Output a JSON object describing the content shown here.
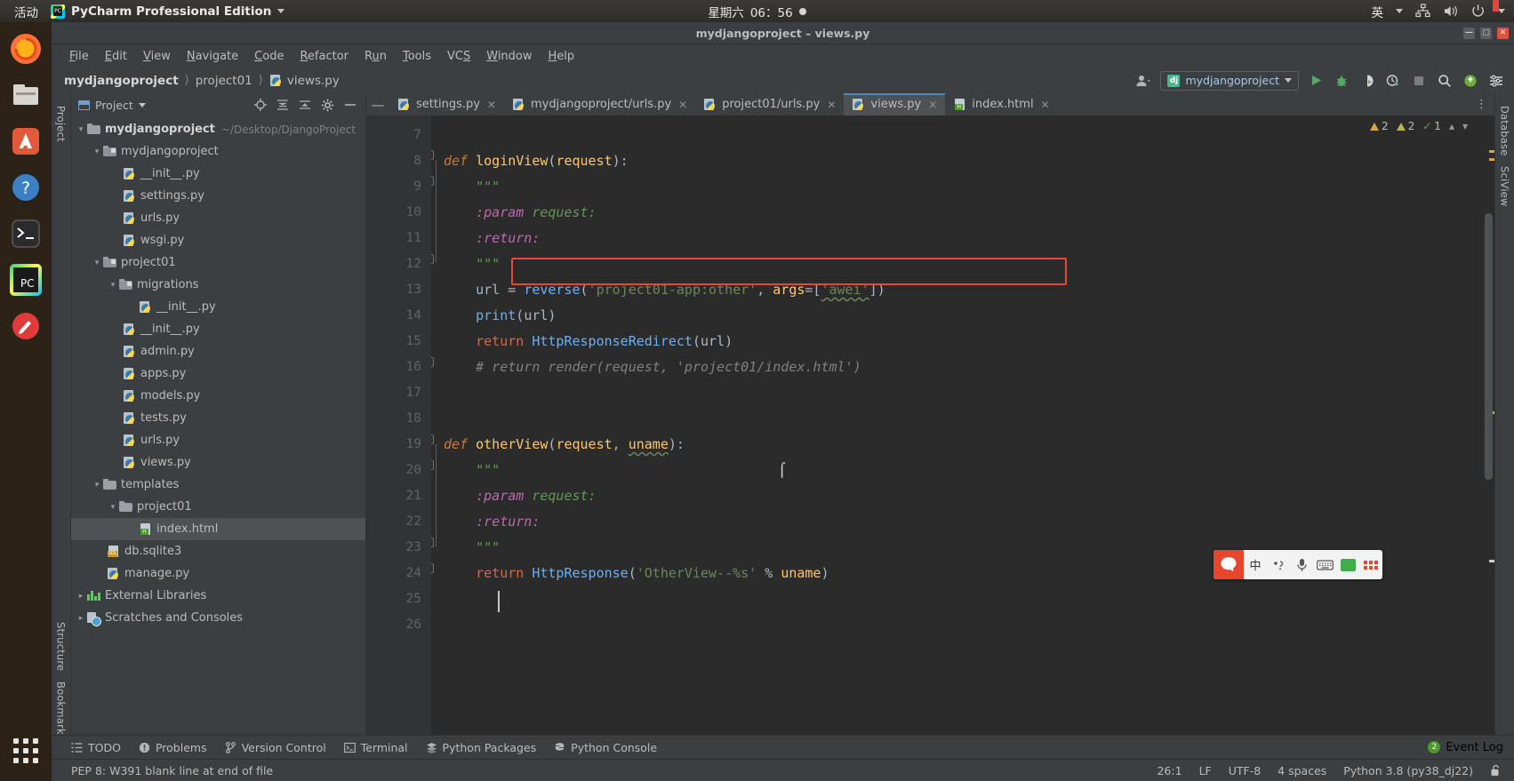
{
  "os_bar": {
    "activities": "活动",
    "app_name": "PyCharm Professional Edition",
    "app_icon": "pycharm-logo-icon",
    "clock_weekday": "星期六",
    "clock_time": "06：56",
    "ime": "英",
    "tray_icons": [
      "network-icon",
      "volume-icon",
      "power-icon",
      "chevron-down-icon"
    ]
  },
  "dock": {
    "items": [
      "firefox-icon",
      "files-icon",
      "software-icon",
      "help-icon",
      "terminal-icon",
      "pycharm-icon",
      "gimp-icon"
    ],
    "apps_label": "show-applications-icon"
  },
  "window": {
    "title": "mydjangoproject – views.py",
    "minimize": "—",
    "maximize": "▢",
    "close": "✕"
  },
  "menubar": {
    "items": [
      "File",
      "Edit",
      "View",
      "Navigate",
      "Code",
      "Refactor",
      "Run",
      "Tools",
      "VCS",
      "Window",
      "Help"
    ]
  },
  "navbar": {
    "breadcrumbs": [
      "mydjangoproject",
      "project01",
      "views.py"
    ],
    "run_config": "mydjangoproject",
    "run_config_icon": "django-icon",
    "icons": [
      "user-icon",
      "run-icon",
      "debug-icon",
      "run-coverage-icon",
      "profile-icon",
      "stop-icon",
      "search-icon",
      "updates-icon",
      "settings-icon"
    ]
  },
  "project_panel": {
    "title": "Project",
    "header_icons": [
      "locate-icon",
      "expand-all-icon",
      "collapse-all-icon",
      "gear-icon",
      "hide-icon"
    ],
    "tree": [
      {
        "label": "mydjangoproject",
        "path": "~/Desktop/DjangoProject",
        "indent": 0,
        "arrow": "open",
        "icon": "folder",
        "bold": true
      },
      {
        "label": "mydjangoproject",
        "path": "",
        "indent": 1,
        "arrow": "open",
        "icon": "folder-module",
        "bold": false
      },
      {
        "label": "__init__.py",
        "path": "",
        "indent": 2,
        "arrow": "none",
        "icon": "python-file",
        "bold": false
      },
      {
        "label": "settings.py",
        "path": "",
        "indent": 2,
        "arrow": "none",
        "icon": "python-file",
        "bold": false
      },
      {
        "label": "urls.py",
        "path": "",
        "indent": 2,
        "arrow": "none",
        "icon": "python-file",
        "bold": false
      },
      {
        "label": "wsgi.py",
        "path": "",
        "indent": 2,
        "arrow": "none",
        "icon": "python-file",
        "bold": false
      },
      {
        "label": "project01",
        "path": "",
        "indent": 1,
        "arrow": "open",
        "icon": "folder-module",
        "bold": false
      },
      {
        "label": "migrations",
        "path": "",
        "indent": 2,
        "arrow": "open",
        "icon": "folder-module",
        "bold": false
      },
      {
        "label": "__init__.py",
        "path": "",
        "indent": 3,
        "arrow": "none",
        "icon": "python-file",
        "bold": false
      },
      {
        "label": "__init__.py",
        "path": "",
        "indent": 2,
        "arrow": "none",
        "icon": "python-file",
        "bold": false
      },
      {
        "label": "admin.py",
        "path": "",
        "indent": 2,
        "arrow": "none",
        "icon": "python-file",
        "bold": false
      },
      {
        "label": "apps.py",
        "path": "",
        "indent": 2,
        "arrow": "none",
        "icon": "python-file",
        "bold": false
      },
      {
        "label": "models.py",
        "path": "",
        "indent": 2,
        "arrow": "none",
        "icon": "python-file",
        "bold": false
      },
      {
        "label": "tests.py",
        "path": "",
        "indent": 2,
        "arrow": "none",
        "icon": "python-file",
        "bold": false
      },
      {
        "label": "urls.py",
        "path": "",
        "indent": 2,
        "arrow": "none",
        "icon": "python-file",
        "bold": false
      },
      {
        "label": "views.py",
        "path": "",
        "indent": 2,
        "arrow": "none",
        "icon": "python-file",
        "bold": false
      },
      {
        "label": "templates",
        "path": "",
        "indent": 1,
        "arrow": "open",
        "icon": "folder",
        "bold": false
      },
      {
        "label": "project01",
        "path": "",
        "indent": 2,
        "arrow": "open",
        "icon": "folder",
        "bold": false
      },
      {
        "label": "index.html",
        "path": "",
        "indent": 3,
        "arrow": "none",
        "icon": "html-file",
        "bold": false,
        "selected": true
      },
      {
        "label": "db.sqlite3",
        "path": "",
        "indent": 1,
        "arrow": "none",
        "icon": "sql-file",
        "bold": false
      },
      {
        "label": "manage.py",
        "path": "",
        "indent": 1,
        "arrow": "none",
        "icon": "python-file",
        "bold": false
      },
      {
        "label": "External Libraries",
        "path": "",
        "indent": 0,
        "arrow": "closed",
        "icon": "libraries",
        "bold": false
      },
      {
        "label": "Scratches and Consoles",
        "path": "",
        "indent": 0,
        "arrow": "closed",
        "icon": "scratches",
        "bold": false
      }
    ]
  },
  "side_strips": {
    "left_top": "Project",
    "left_bottom1": "Structure",
    "left_bottom2": "Bookmarks",
    "right_top": "Database",
    "right_second": "SciView"
  },
  "tabs": [
    {
      "label": "settings.py",
      "icon": "python-file",
      "active": false
    },
    {
      "label": "mydjangoproject/urls.py",
      "icon": "python-file",
      "active": false
    },
    {
      "label": "project01/urls.py",
      "icon": "python-file",
      "active": false
    },
    {
      "label": "views.py",
      "icon": "python-file",
      "active": true
    },
    {
      "label": "index.html",
      "icon": "html-file",
      "active": false
    }
  ],
  "inspections": {
    "warnings": "2",
    "weak_warnings": "2",
    "typos": "1"
  },
  "editor": {
    "first_line": 7,
    "lines": [
      {
        "n": 7,
        "text": ""
      },
      {
        "n": 8,
        "text": "def loginView(request):"
      },
      {
        "n": 9,
        "text": "    \"\"\""
      },
      {
        "n": 10,
        "text": "    :param request:"
      },
      {
        "n": 11,
        "text": "    :return:"
      },
      {
        "n": 12,
        "text": "    \"\"\""
      },
      {
        "n": 13,
        "text": "    url = reverse('project01-app:other', args=['awei'])"
      },
      {
        "n": 14,
        "text": "    print(url)"
      },
      {
        "n": 15,
        "text": "    return HttpResponseRedirect(url)"
      },
      {
        "n": 16,
        "text": "    # return render(request, 'project01/index.html')"
      },
      {
        "n": 17,
        "text": ""
      },
      {
        "n": 18,
        "text": ""
      },
      {
        "n": 19,
        "text": "def otherView(request, uname):"
      },
      {
        "n": 20,
        "text": "    \"\"\""
      },
      {
        "n": 21,
        "text": "    :param request:"
      },
      {
        "n": 22,
        "text": "    :return:"
      },
      {
        "n": 23,
        "text": "    \"\"\""
      },
      {
        "n": 24,
        "text": "    return HttpResponse('OtherView--%s' % uname)"
      },
      {
        "n": 25,
        "text": ""
      },
      {
        "n": 26,
        "text": ""
      }
    ],
    "highlight_color": "#e8483c",
    "highlighted_line": 13
  },
  "ime_toolbar": {
    "logo": "sogou-icon",
    "mode": "中",
    "items": [
      "comma-icon",
      "mic-icon",
      "keyboard-icon",
      "toolbox-icon",
      "apps-icon"
    ]
  },
  "bottom_bar": {
    "items": [
      {
        "label": "TODO",
        "icon": "todo-icon"
      },
      {
        "label": "Problems",
        "icon": "problems-icon"
      },
      {
        "label": "Version Control",
        "icon": "branch-icon"
      },
      {
        "label": "Terminal",
        "icon": "terminal-icon"
      },
      {
        "label": "Python Packages",
        "icon": "packages-icon"
      },
      {
        "label": "Python Console",
        "icon": "console-icon"
      }
    ],
    "event_log": "Event Log",
    "event_log_count": "2"
  },
  "statusbar": {
    "message": "PEP 8: W391 blank line at end of file",
    "caret": "26:1",
    "line_sep": "LF",
    "encoding": "UTF-8",
    "indent": "4 spaces",
    "interpreter": "Python 3.8 (py38_dj22)",
    "lock_icon": "unlocked-icon"
  },
  "colors": {
    "accent_blue": "#4a88c7",
    "panel": "#3c3f41",
    "editor_bg": "#2b2b2b",
    "gutter_bg": "#313335",
    "error_red": "#e8483c",
    "django_green": "#44b78b"
  }
}
